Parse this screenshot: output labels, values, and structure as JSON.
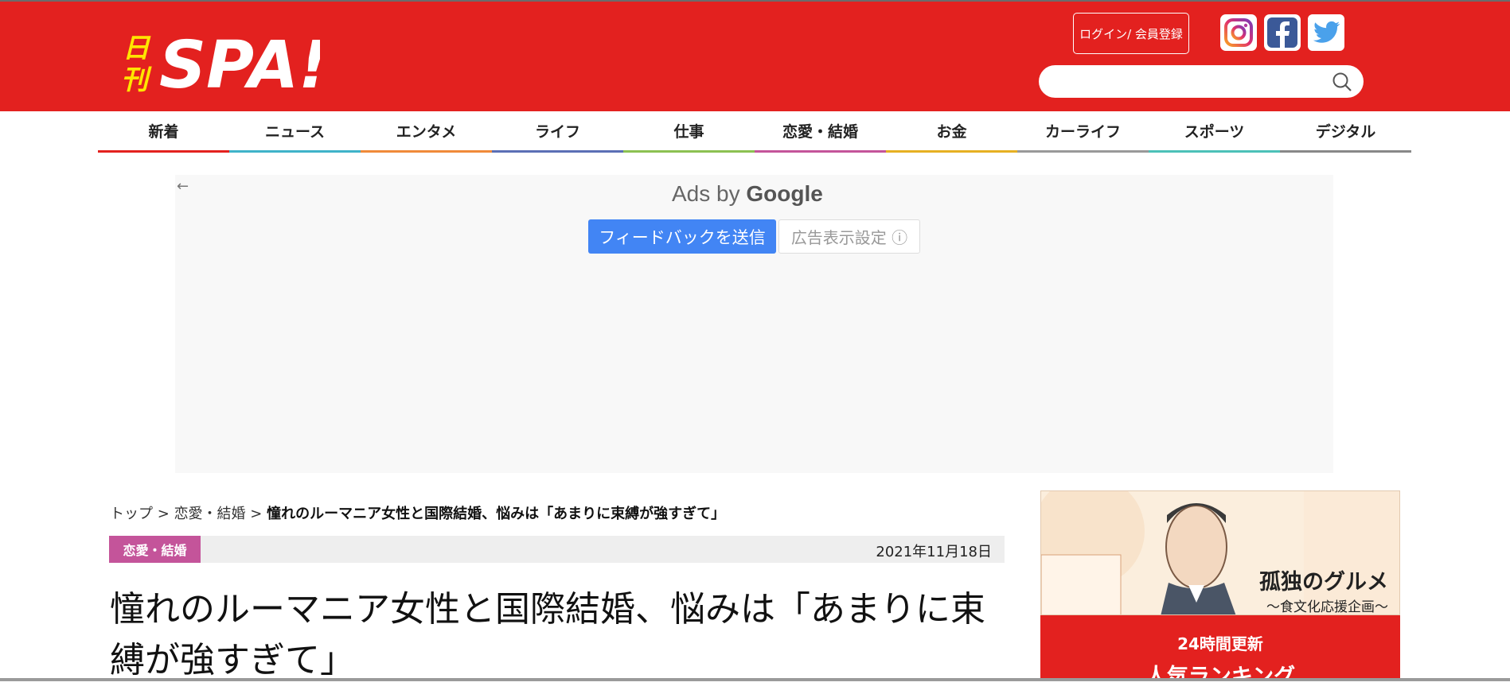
{
  "header": {
    "logo_small": "日刊",
    "logo_big": "SPA!",
    "login_label": "ログイン/ 会員登録",
    "search_placeholder": ""
  },
  "nav": {
    "items": [
      {
        "label": "新着",
        "color": "#e3211f"
      },
      {
        "label": "ニュース",
        "color": "#3fb3c9"
      },
      {
        "label": "エンタメ",
        "color": "#f08a3a"
      },
      {
        "label": "ライフ",
        "color": "#5b6fb5"
      },
      {
        "label": "仕事",
        "color": "#8cc152"
      },
      {
        "label": "恋愛・結婚",
        "color": "#c4549a"
      },
      {
        "label": "お金",
        "color": "#e6b022"
      },
      {
        "label": "カーライフ",
        "color": "#999999"
      },
      {
        "label": "スポーツ",
        "color": "#4cc1b8"
      },
      {
        "label": "デジタル",
        "color": "#888888"
      }
    ]
  },
  "ad": {
    "back_icon": "←",
    "ads_by": "Ads by",
    "google": "Google",
    "feedback_label": "フィードバックを送信",
    "settings_label": "広告表示設定 ⓘ"
  },
  "breadcrumb": {
    "top": "トップ",
    "sep": ">",
    "category": "恋愛・結婚",
    "current": "憧れのルーマニア女性と国際結婚、悩みは「あまりに束縛が強すぎて」"
  },
  "article": {
    "category": "恋愛・結婚",
    "date": "2021年11月18日",
    "title": "憧れのルーマニア女性と国際結婚、悩みは「あまりに束縛が強すぎて」"
  },
  "sidebar": {
    "banner_title": "孤独のグルメ",
    "banner_sub": "〜食文化応援企画〜",
    "ranking_update": "24時間更新",
    "ranking_title": "人気ランキング"
  },
  "colors": {
    "brand_red": "#e3211f",
    "logo_yellow": "#ffe600",
    "google_blue": "#4285f4",
    "category_pink": "#c4549a"
  }
}
